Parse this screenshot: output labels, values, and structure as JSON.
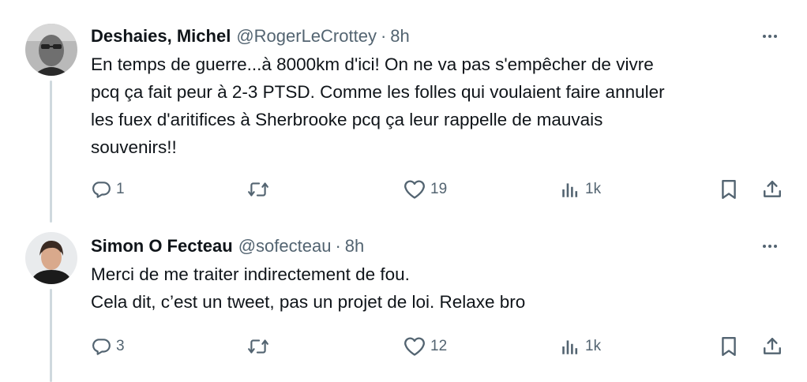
{
  "tweets": [
    {
      "name": "Deshaies, Michel",
      "handle": "@RogerLeCrottey",
      "separator": "·",
      "time": "8h",
      "text": "En temps de guerre...à 8000km d'ici! On ne va pas s'empêcher de vivre\npcq ça fait peur à 2-3 PTSD. Comme les folles qui voulaient faire annuler\nles fuex d'aritifices à Sherbrooke pcq ça leur rappelle de mauvais\nsouvenirs!!",
      "replies": "1",
      "likes": "19",
      "views": "1k"
    },
    {
      "name": "Simon O Fecteau",
      "handle": "@sofecteau",
      "separator": "·",
      "time": "8h",
      "text": "Merci de me traiter indirectement de fou.\nCela dit, c’est un tweet, pas un projet de loi. Relaxe bro",
      "replies": "3",
      "likes": "12",
      "views": "1k"
    }
  ],
  "icons": [
    "more-icon",
    "reply-icon",
    "retweet-icon",
    "like-icon",
    "views-icon",
    "bookmark-icon",
    "share-icon"
  ],
  "colors": {
    "text": "#0f1419",
    "secondary": "#536471",
    "thread_line": "#cfd9de"
  }
}
